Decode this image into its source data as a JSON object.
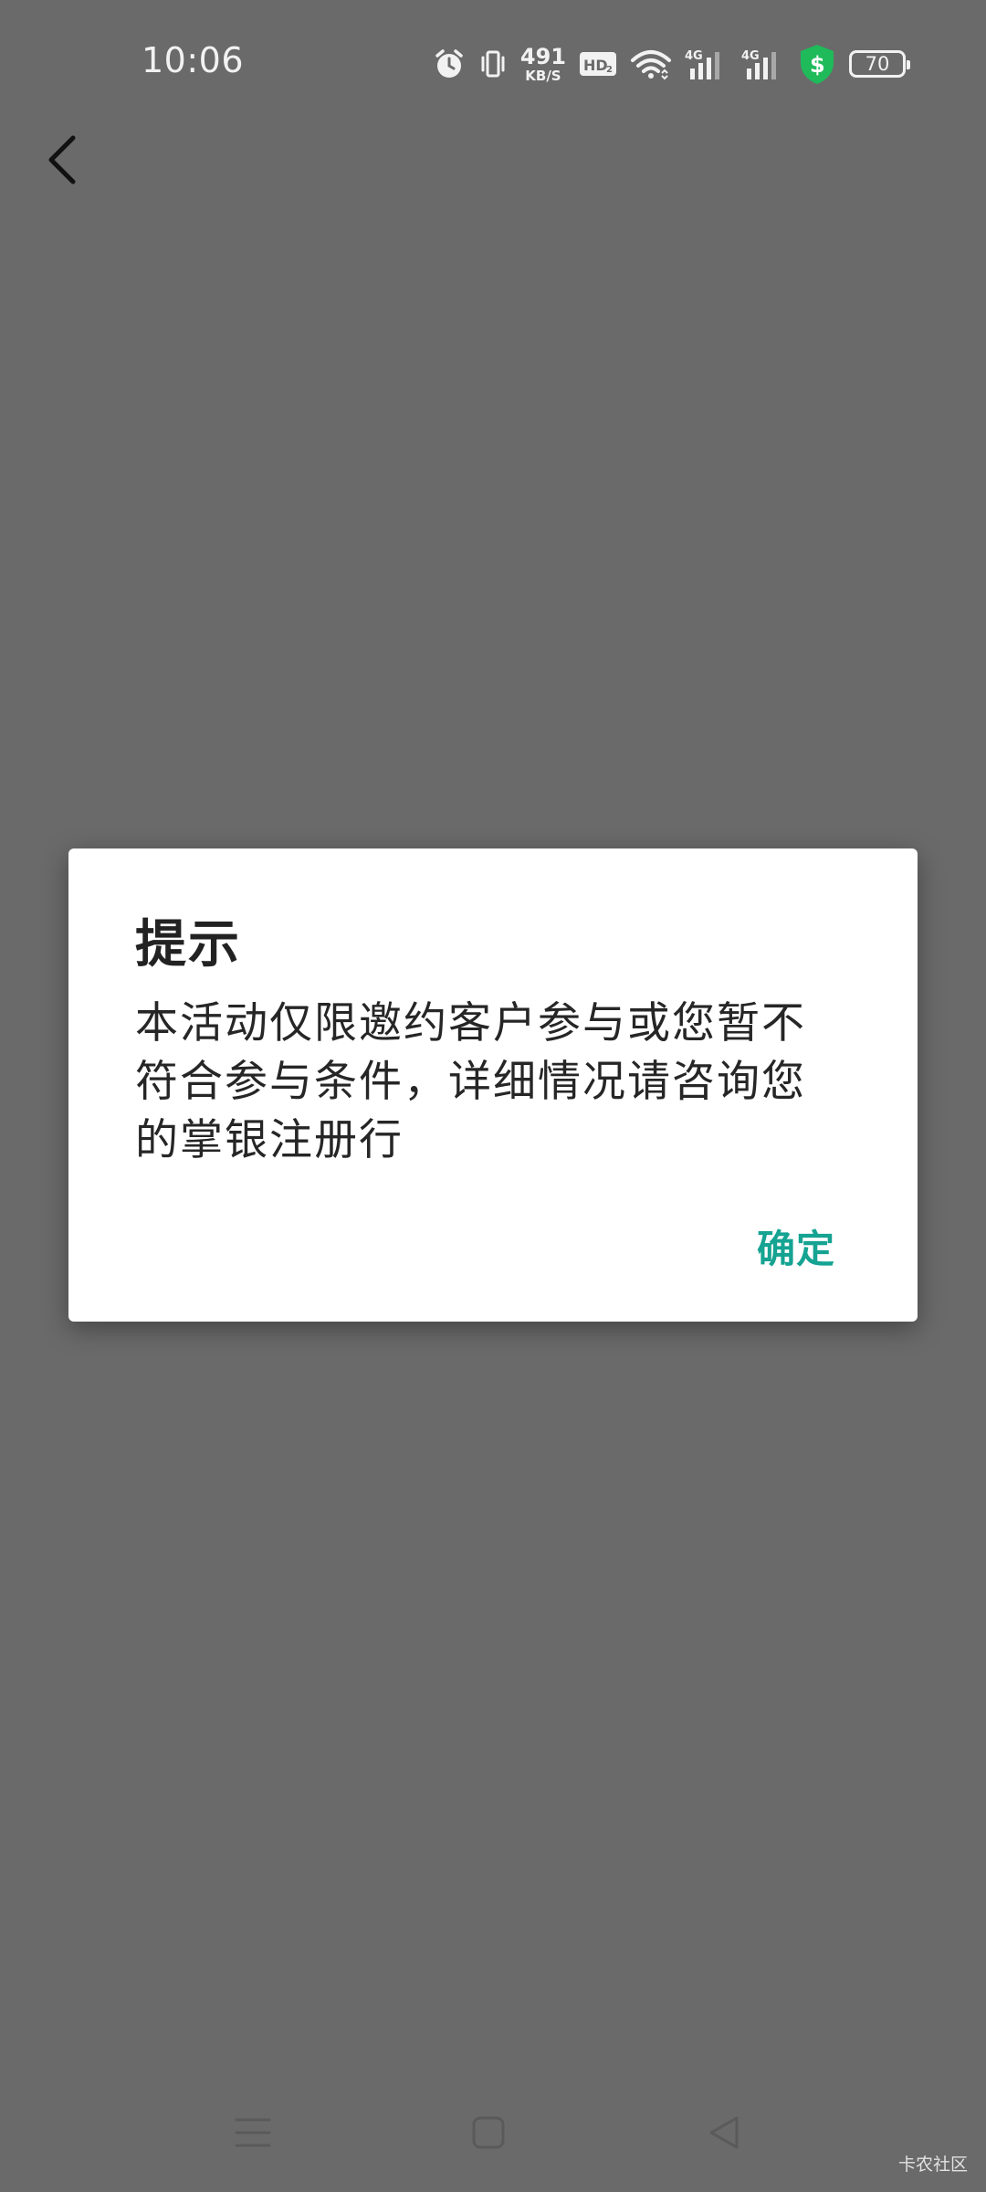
{
  "status_bar": {
    "time": "10:06",
    "net_speed_value": "491",
    "net_speed_unit": "KB/S",
    "hd_label": "HD",
    "hd_sub": "2",
    "sim1_label": "4G",
    "sim2_label": "4G",
    "battery_level": "70",
    "icons": [
      "alarm-icon",
      "vibrate-icon",
      "hd-voice-icon",
      "wifi-icon",
      "signal-icon",
      "signal-icon",
      "security-shield-icon",
      "battery-icon"
    ]
  },
  "toolbar": {
    "back_icon": "chevron-left-icon"
  },
  "dialog": {
    "title": "提示",
    "message": "本活动仅限邀约客户参与或您暂不符合参与条件，详细情况请咨询您的掌银注册行",
    "confirm_label": "确定",
    "accent_color": "#15a392"
  },
  "nav_bar": {
    "icons": [
      "menu-icon",
      "home-square-icon",
      "back-triangle-icon"
    ]
  },
  "watermark": {
    "text": "卡农社区"
  }
}
